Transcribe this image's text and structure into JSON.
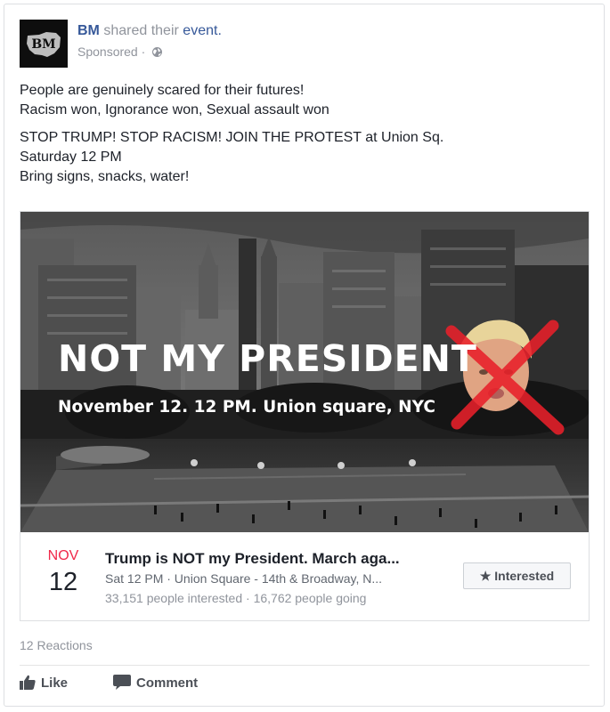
{
  "post": {
    "author": "BM",
    "action_text": "shared their",
    "object_text": "event.",
    "sponsored_label": "Sponsored",
    "separator": "·",
    "avatar_text": "BM",
    "message_lines": [
      "People are genuinely scared for their futures!",
      "Racism won, Ignorance won, Sexual assault won"
    ],
    "message_lines_2": [
      "STOP TRUMP! STOP RACISM! JOIN THE PROTEST at Union Sq.",
      "Saturday 12 PM",
      "Bring signs, snacks, water!"
    ]
  },
  "event_image": {
    "title": "NOT MY PRESIDENT",
    "subtitle": "November 12. 12 PM. Union square, NYC"
  },
  "event": {
    "month": "NOV",
    "day": "12",
    "title": "Trump is NOT my President. March aga...",
    "location_line": "Sat 12 PM · Union Square - 14th & Broadway, N...",
    "stats_line": "33,151 people interested · 16,762 people going",
    "interested_label": "Interested",
    "interested_icon": "star-icon"
  },
  "footer": {
    "reactions": "12 Reactions",
    "like_label": "Like",
    "comment_label": "Comment"
  },
  "colors": {
    "link_blue": "#365899",
    "meta_gray": "#90949c",
    "month_red": "#f02849",
    "cross_red": "#e8202a"
  }
}
